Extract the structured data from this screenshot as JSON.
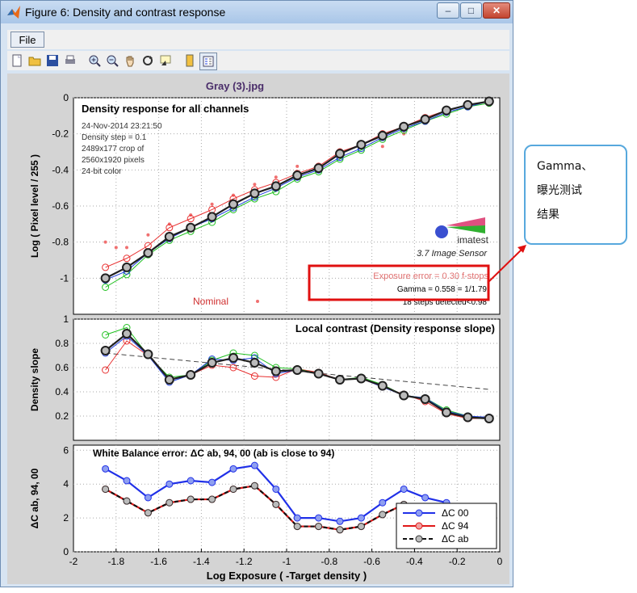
{
  "window": {
    "title": "Figure 6: Density and contrast response",
    "min_icon": "minimize-icon",
    "max_icon": "maximize-icon",
    "close_icon": "close-icon"
  },
  "menu": {
    "file": "File"
  },
  "toolbar": {
    "icons": [
      "new-file-icon",
      "open-folder-icon",
      "save-icon",
      "print-icon",
      "zoom-in-icon",
      "zoom-out-icon",
      "pan-hand-icon",
      "rotate-icon",
      "data-cursor-icon",
      "colorbar-icon",
      "legend-icon"
    ]
  },
  "figure_title": "Gray (3).jpg",
  "callout": {
    "lines": [
      "Gamma、",
      "曝光测试",
      "结果"
    ],
    "border_color": "#57a8dd"
  },
  "highlight_color": "#e01010",
  "chart_data": [
    {
      "type": "line",
      "title": "Density response for all channels",
      "ylabel": "Log ( Pixel level / 255 )",
      "xlim": [
        -2,
        0
      ],
      "ylim": [
        -1.2,
        0
      ],
      "yticks": [
        0,
        -0.2,
        -0.4,
        -0.6,
        -0.8,
        -1
      ],
      "info_lines": [
        "24-Nov-2014 23:21:50",
        "Density step = 0.1",
        "2489x177 crop of",
        "2560x1920 pixels",
        "24-bit color"
      ],
      "logo_text": "imatest",
      "logo_sub": "3.7  Image Sensor",
      "exposure_text": "Exposure error = 0.30 f-stops",
      "gamma_text": "Gamma = 0.558 = 1/1.79",
      "steps_text": "18 steps detected<0.98",
      "nominal_label": "Nominal",
      "x": [
        -1.85,
        -1.75,
        -1.65,
        -1.55,
        -1.45,
        -1.35,
        -1.25,
        -1.15,
        -1.05,
        -0.95,
        -0.85,
        -0.75,
        -0.65,
        -0.55,
        -0.45,
        -0.35,
        -0.25,
        -0.15,
        -0.05
      ],
      "series": [
        {
          "color": "#e83030",
          "values": [
            -0.94,
            -0.89,
            -0.82,
            -0.72,
            -0.67,
            -0.62,
            -0.56,
            -0.51,
            -0.47,
            -0.42,
            -0.38,
            -0.3,
            -0.26,
            -0.2,
            -0.16,
            -0.11,
            -0.07,
            -0.04,
            -0.02
          ]
        },
        {
          "color": "#20c020",
          "values": [
            -1.05,
            -0.98,
            -0.87,
            -0.79,
            -0.74,
            -0.69,
            -0.62,
            -0.56,
            -0.52,
            -0.45,
            -0.41,
            -0.34,
            -0.29,
            -0.23,
            -0.18,
            -0.13,
            -0.09,
            -0.05,
            -0.03
          ]
        },
        {
          "color": "#2040e0",
          "values": [
            -1.01,
            -0.96,
            -0.86,
            -0.78,
            -0.72,
            -0.67,
            -0.61,
            -0.55,
            -0.5,
            -0.44,
            -0.4,
            -0.33,
            -0.28,
            -0.22,
            -0.17,
            -0.13,
            -0.08,
            -0.05,
            -0.02
          ]
        },
        {
          "color": "#202020",
          "values": [
            -1.0,
            -0.94,
            -0.86,
            -0.77,
            -0.72,
            -0.66,
            -0.59,
            -0.53,
            -0.49,
            -0.43,
            -0.39,
            -0.31,
            -0.26,
            -0.21,
            -0.16,
            -0.12,
            -0.07,
            -0.04,
            -0.02
          ]
        }
      ],
      "nominal": {
        "x": [
          -1.85,
          -1.8,
          -1.75,
          -1.65,
          -1.55,
          -1.45,
          -1.35,
          -1.25,
          -1.15,
          -1.05,
          -0.95,
          -0.85,
          -0.75,
          -0.65,
          -0.55,
          -0.45,
          -0.35,
          -0.25,
          -0.15
        ],
        "values": [
          -0.8,
          -0.83,
          -0.83,
          -0.76,
          -0.7,
          -0.65,
          -0.59,
          -0.54,
          -0.48,
          -0.44,
          -0.38,
          -0.37,
          -0.33,
          -0.26,
          -0.27,
          -0.2,
          -0.14,
          -0.08,
          -0.03
        ]
      }
    },
    {
      "type": "line",
      "title": "Local contrast (Density response slope)",
      "ylabel": "Density slope",
      "xlim": [
        -2,
        0
      ],
      "ylim": [
        0,
        1
      ],
      "yticks": [
        1,
        0.8,
        0.6,
        0.4,
        0.2
      ],
      "x": [
        -1.85,
        -1.75,
        -1.65,
        -1.55,
        -1.45,
        -1.35,
        -1.25,
        -1.15,
        -1.05,
        -0.95,
        -0.85,
        -0.75,
        -0.65,
        -0.55,
        -0.45,
        -0.35,
        -0.25,
        -0.15,
        -0.05
      ],
      "series": [
        {
          "color": "#e83030",
          "values": [
            0.58,
            0.82,
            0.7,
            0.5,
            0.54,
            0.62,
            0.6,
            0.53,
            0.52,
            0.59,
            0.56,
            0.5,
            0.51,
            0.44,
            0.38,
            0.32,
            0.22,
            0.18,
            0.18
          ]
        },
        {
          "color": "#20c020",
          "values": [
            0.87,
            0.93,
            0.7,
            0.52,
            0.54,
            0.66,
            0.72,
            0.7,
            0.6,
            0.59,
            0.55,
            0.5,
            0.52,
            0.46,
            0.37,
            0.35,
            0.25,
            0.2,
            0.18
          ]
        },
        {
          "color": "#2040e0",
          "values": [
            0.72,
            0.86,
            0.7,
            0.48,
            0.54,
            0.67,
            0.66,
            0.68,
            0.55,
            0.58,
            0.55,
            0.5,
            0.51,
            0.44,
            0.37,
            0.35,
            0.24,
            0.2,
            0.19
          ]
        },
        {
          "color": "#202020",
          "values": [
            0.74,
            0.88,
            0.71,
            0.5,
            0.54,
            0.64,
            0.68,
            0.64,
            0.57,
            0.58,
            0.55,
            0.5,
            0.51,
            0.45,
            0.37,
            0.34,
            0.23,
            0.19,
            0.18
          ]
        }
      ],
      "trend": {
        "x": [
          -1.85,
          -0.05
        ],
        "values": [
          0.72,
          0.42
        ]
      }
    },
    {
      "type": "line",
      "title": "White Balance error:  ΔC ab, 94, 00 (ab is close to 94)",
      "ylabel": "ΔC ab, 94, 00",
      "xlabel": "Log Exposure ( -Target density )",
      "xlim": [
        -2,
        0
      ],
      "ylim": [
        0,
        6.3
      ],
      "yticks": [
        0,
        2,
        4,
        6
      ],
      "xticks": [
        -2,
        -1.8,
        -1.6,
        -1.4,
        -1.2,
        -1,
        -0.8,
        -0.6,
        -0.4,
        -0.2,
        0
      ],
      "legend_position": "bottom-right",
      "x": [
        -1.85,
        -1.75,
        -1.65,
        -1.55,
        -1.45,
        -1.35,
        -1.25,
        -1.15,
        -1.05,
        -0.95,
        -0.85,
        -0.75,
        -0.65,
        -0.55,
        -0.45,
        -0.35,
        -0.25,
        -0.15,
        -0.05
      ],
      "series": [
        {
          "name": "ΔC 00",
          "color": "#2030e8",
          "values": [
            4.9,
            4.2,
            3.2,
            4.0,
            4.2,
            4.1,
            4.9,
            5.1,
            3.7,
            2.0,
            2.0,
            1.8,
            2.0,
            2.9,
            3.7,
            3.2,
            2.9,
            2.5,
            2.2
          ]
        },
        {
          "name": "ΔC 94",
          "color": "#e01818",
          "values": [
            3.7,
            3.0,
            2.3,
            2.9,
            3.1,
            3.1,
            3.7,
            3.9,
            2.8,
            1.5,
            1.5,
            1.3,
            1.5,
            2.2,
            2.8,
            2.4,
            2.1,
            1.8,
            1.6
          ]
        },
        {
          "name": "ΔC ab",
          "color": "#888888",
          "values": [
            3.7,
            3.0,
            2.3,
            2.9,
            3.1,
            3.1,
            3.7,
            3.9,
            2.8,
            1.5,
            1.5,
            1.3,
            1.5,
            2.2,
            2.8,
            2.4,
            2.1,
            1.8,
            1.6
          ]
        }
      ]
    }
  ]
}
